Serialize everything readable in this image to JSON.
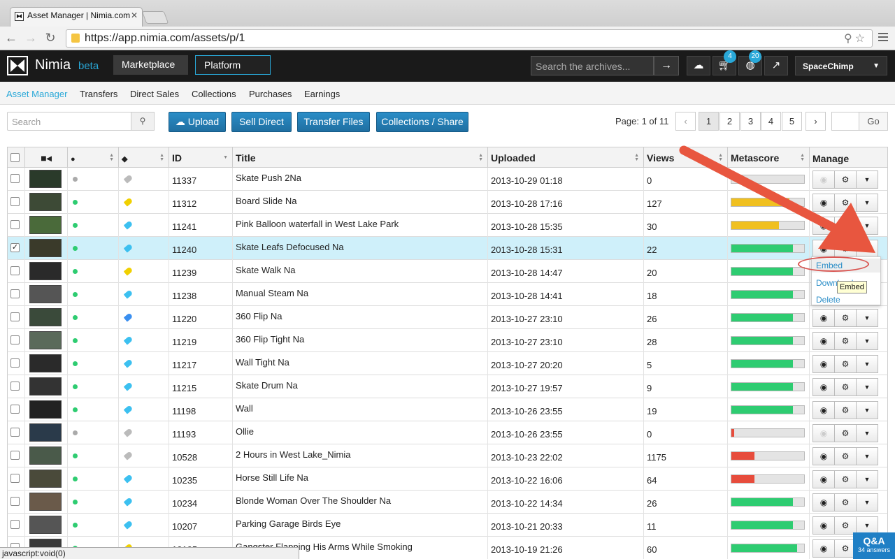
{
  "browser": {
    "tab_title": "Asset Manager | Nimia.com",
    "url": "https://app.nimia.com/assets/p/1",
    "status_text": "javascript:void(0)"
  },
  "header": {
    "logo": "Nimia",
    "beta": "beta",
    "nav": [
      "Marketplace",
      "Platform"
    ],
    "archive_placeholder": "Search the archives...",
    "archive_go": "→",
    "cart_badge": "4",
    "globe_badge": "20",
    "user": "SpaceChimp"
  },
  "subnav": [
    "Asset Manager",
    "Transfers",
    "Direct Sales",
    "Collections",
    "Purchases",
    "Earnings"
  ],
  "actions": {
    "search_placeholder": "Search",
    "upload": "Upload",
    "sell_direct": "Sell Direct",
    "transfer_files": "Transfer Files",
    "collections_share": "Collections / Share"
  },
  "pager": {
    "label": "Page: 1 of 11",
    "prev": "‹",
    "next": "›",
    "pages": [
      "1",
      "2",
      "3",
      "4",
      "5"
    ],
    "go": "Go"
  },
  "columns": [
    "ID",
    "Title",
    "Uploaded",
    "Views",
    "Metascore",
    "Manage"
  ],
  "colors": {
    "accent": "#29a8d8",
    "green": "#2ecc71",
    "yellow": "#f0c020",
    "red": "#e74c3c",
    "grey": "#aaaaaa",
    "tag_blue": "#3cc0f0"
  },
  "rows": [
    {
      "id": "11337",
      "title": "Skate Push 2Na",
      "uploaded": "2013-10-29 01:18",
      "views": "0",
      "score": 0.0,
      "score_color": "#aaaaaa",
      "status": "#aaaaaa",
      "tag": "#bbbbbb",
      "checked": false,
      "thumb": "#2a3a2a",
      "view_enabled": false
    },
    {
      "id": "11312",
      "title": "Board Slide Na",
      "uploaded": "2013-10-28 17:16",
      "views": "127",
      "score": 0.8,
      "score_color": "#f0c020",
      "status": "#2ecc71",
      "tag": "#f0d000",
      "checked": false,
      "thumb": "#3d4a36",
      "view_enabled": true
    },
    {
      "id": "11241",
      "title": "Pink Balloon waterfall in West Lake Park",
      "uploaded": "2013-10-28 15:35",
      "views": "30",
      "score": 0.65,
      "score_color": "#f0c020",
      "status": "#2ecc71",
      "tag": "#3cc0f0",
      "checked": false,
      "thumb": "#4a6a3a",
      "view_enabled": true
    },
    {
      "id": "11240",
      "title": "Skate Leafs Defocused Na",
      "uploaded": "2013-10-28 15:31",
      "views": "22",
      "score": 0.85,
      "score_color": "#2ecc71",
      "status": "#2ecc71",
      "tag": "#3cc0f0",
      "checked": true,
      "thumb": "#3a3a2a",
      "view_enabled": true
    },
    {
      "id": "11239",
      "title": "Skate Walk Na",
      "uploaded": "2013-10-28 14:47",
      "views": "20",
      "score": 0.85,
      "score_color": "#2ecc71",
      "status": "#2ecc71",
      "tag": "#f0d000",
      "checked": false,
      "thumb": "#2a2a2a",
      "view_enabled": true
    },
    {
      "id": "11238",
      "title": "Manual Steam Na",
      "uploaded": "2013-10-28 14:41",
      "views": "18",
      "score": 0.85,
      "score_color": "#2ecc71",
      "status": "#2ecc71",
      "tag": "#3cc0f0",
      "checked": false,
      "thumb": "#555555",
      "view_enabled": true
    },
    {
      "id": "11220",
      "title": "360 Flip Na",
      "uploaded": "2013-10-27 23:10",
      "views": "26",
      "score": 0.85,
      "score_color": "#2ecc71",
      "status": "#2ecc71",
      "tag": "#3a8ff0",
      "checked": false,
      "thumb": "#3a4a3a",
      "view_enabled": true
    },
    {
      "id": "11219",
      "title": "360 Flip Tight Na",
      "uploaded": "2013-10-27 23:10",
      "views": "28",
      "score": 0.85,
      "score_color": "#2ecc71",
      "status": "#2ecc71",
      "tag": "#3cc0f0",
      "checked": false,
      "thumb": "#5a6a5a",
      "view_enabled": true
    },
    {
      "id": "11217",
      "title": "Wall Tight Na",
      "uploaded": "2013-10-27 20:20",
      "views": "5",
      "score": 0.85,
      "score_color": "#2ecc71",
      "status": "#2ecc71",
      "tag": "#3cc0f0",
      "checked": false,
      "thumb": "#2a2a2a",
      "view_enabled": true
    },
    {
      "id": "11215",
      "title": "Skate Drum Na",
      "uploaded": "2013-10-27 19:57",
      "views": "9",
      "score": 0.85,
      "score_color": "#2ecc71",
      "status": "#2ecc71",
      "tag": "#3cc0f0",
      "checked": false,
      "thumb": "#333333",
      "view_enabled": true
    },
    {
      "id": "11198",
      "title": "Wall",
      "uploaded": "2013-10-26 23:55",
      "views": "19",
      "score": 0.85,
      "score_color": "#2ecc71",
      "status": "#2ecc71",
      "tag": "#3cc0f0",
      "checked": false,
      "thumb": "#222222",
      "view_enabled": true
    },
    {
      "id": "11193",
      "title": "Ollie",
      "uploaded": "2013-10-26 23:55",
      "views": "0",
      "score": 0.04,
      "score_color": "#e74c3c",
      "status": "#aaaaaa",
      "tag": "#bbbbbb",
      "checked": false,
      "thumb": "#2a3a4a",
      "view_enabled": false
    },
    {
      "id": "10528",
      "title": "2 Hours in West Lake_Nimia",
      "uploaded": "2013-10-23 22:02",
      "views": "1175",
      "score": 0.32,
      "score_color": "#e74c3c",
      "status": "#2ecc71",
      "tag": "#bbbbbb",
      "checked": false,
      "thumb": "#4a5a4a",
      "view_enabled": true
    },
    {
      "id": "10235",
      "title": "Horse Still Life Na",
      "uploaded": "2013-10-22 16:06",
      "views": "64",
      "score": 0.32,
      "score_color": "#e74c3c",
      "status": "#2ecc71",
      "tag": "#3cc0f0",
      "checked": false,
      "thumb": "#4a4a3a",
      "view_enabled": true
    },
    {
      "id": "10234",
      "title": "Blonde Woman Over The Shoulder Na",
      "uploaded": "2013-10-22 14:34",
      "views": "26",
      "score": 0.85,
      "score_color": "#2ecc71",
      "status": "#2ecc71",
      "tag": "#3cc0f0",
      "checked": false,
      "thumb": "#6a5a4a",
      "view_enabled": true
    },
    {
      "id": "10207",
      "title": "Parking Garage Birds Eye",
      "uploaded": "2013-10-21 20:33",
      "views": "11",
      "score": 0.85,
      "score_color": "#2ecc71",
      "status": "#2ecc71",
      "tag": "#3cc0f0",
      "checked": false,
      "thumb": "#555555",
      "view_enabled": true
    },
    {
      "id": "10195",
      "title": "Gangster Flapping His Arms While Smoking",
      "uploaded": "2013-10-19 21:26",
      "views": "60",
      "score": 0.9,
      "score_color": "#2ecc71",
      "status": "#2ecc71",
      "tag": "#f0d000",
      "checked": false,
      "thumb": "#3a3a3a",
      "view_enabled": true
    }
  ],
  "dropdown": {
    "items": [
      "Embed",
      "Download",
      "Delete"
    ],
    "tooltip": "Embed"
  },
  "qa": {
    "title": "Q&A",
    "sub": "34 answers"
  },
  "icons": {
    "video": "video-camera-icon",
    "status": "status-dot-icon",
    "tag": "tag-icon",
    "view": "eye-icon",
    "settings": "gears-icon",
    "caret": "caret-down-icon"
  }
}
